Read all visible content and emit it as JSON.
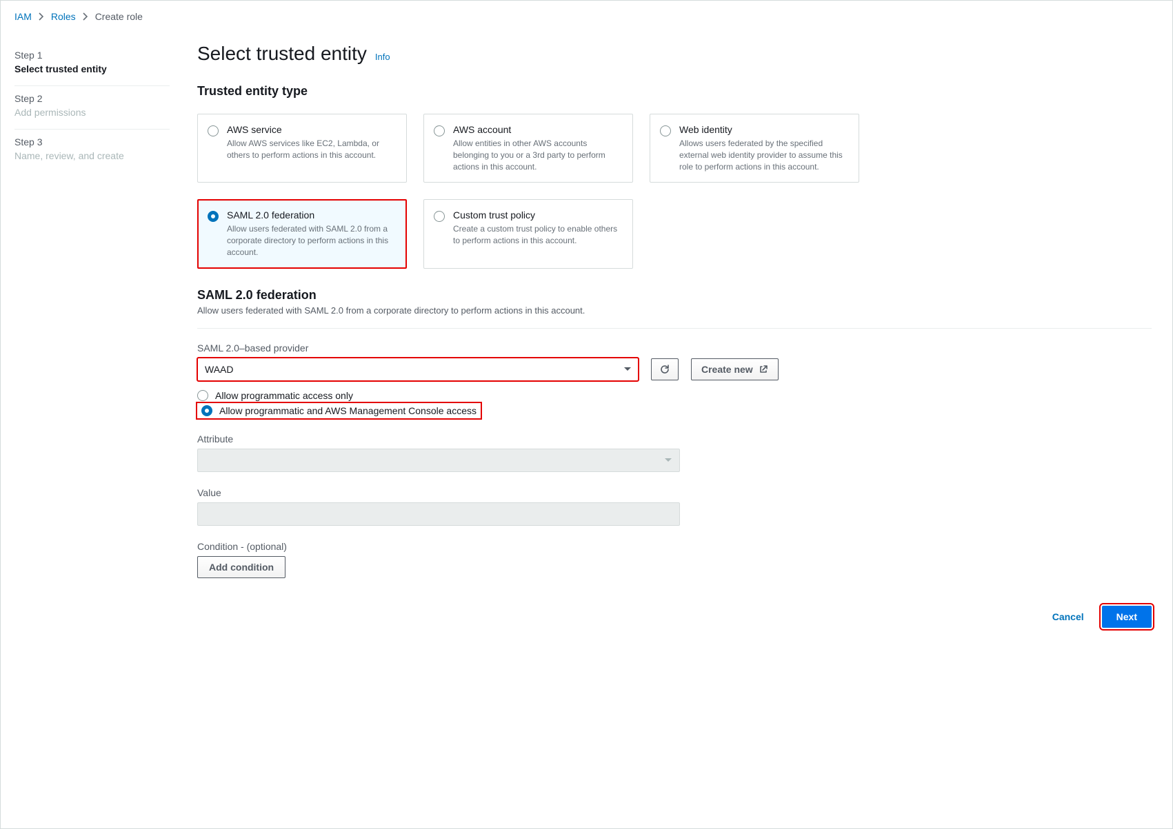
{
  "breadcrumb": {
    "iam": "IAM",
    "roles": "Roles",
    "current": "Create role"
  },
  "steps": [
    {
      "num": "Step 1",
      "title": "Select trusted entity"
    },
    {
      "num": "Step 2",
      "title": "Add permissions"
    },
    {
      "num": "Step 3",
      "title": "Name, review, and create"
    }
  ],
  "page": {
    "title": "Select trusted entity",
    "info": "Info"
  },
  "entity_section": {
    "heading": "Trusted entity type"
  },
  "tiles": [
    {
      "title": "AWS service",
      "desc": "Allow AWS services like EC2, Lambda, or others to perform actions in this account."
    },
    {
      "title": "AWS account",
      "desc": "Allow entities in other AWS accounts belonging to you or a 3rd party to perform actions in this account."
    },
    {
      "title": "Web identity",
      "desc": "Allows users federated by the specified external web identity provider to assume this role to perform actions in this account."
    },
    {
      "title": "SAML 2.0 federation",
      "desc": "Allow users federated with SAML 2.0 from a corporate directory to perform actions in this account."
    },
    {
      "title": "Custom trust policy",
      "desc": "Create a custom trust policy to enable others to perform actions in this account."
    }
  ],
  "saml": {
    "heading": "SAML 2.0 federation",
    "desc": "Allow users federated with SAML 2.0 from a corporate directory to perform actions in this account.",
    "provider_label": "SAML 2.0–based provider",
    "provider_value": "WAAD",
    "create_new": "Create new",
    "access_options": [
      "Allow programmatic access only",
      "Allow programmatic and AWS Management Console access"
    ],
    "attribute_label": "Attribute",
    "value_label": "Value",
    "condition_label": "Condition - (optional)",
    "add_condition": "Add condition"
  },
  "footer": {
    "cancel": "Cancel",
    "next": "Next"
  }
}
